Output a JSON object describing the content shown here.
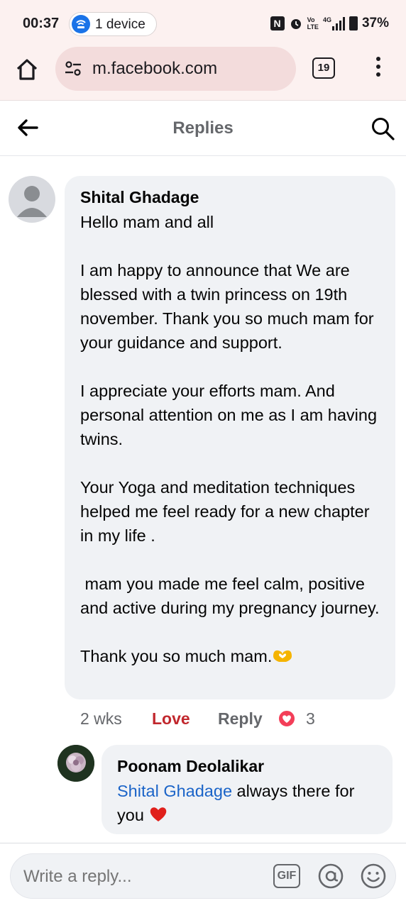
{
  "status_bar": {
    "time": "00:37",
    "device_chip": "1 device",
    "network_top": "Vo",
    "network_bottom": "LTE",
    "signal_label": "4G",
    "battery": "37%"
  },
  "browser": {
    "url": "m.facebook.com",
    "tab_count": "19"
  },
  "header": {
    "title": "Replies"
  },
  "comment": {
    "author": "Shital Ghadage",
    "text": "Hello mam and all\n\nI am happy to announce that We are blessed with a twin princess on 19th november. Thank you so much mam for your guidance and support.\n\nI appreciate your efforts mam. And personal attention on me as I am having twins.\n\nYour Yoga and meditation techniques helped me feel ready for a new chapter in my life .\n\n mam you made me feel calm, positive and active during my pregnancy journey.\n\nThank you so much mam.",
    "age": "2 wks",
    "reaction_label": "Love",
    "reply_label": "Reply",
    "reaction_count": "3"
  },
  "reply": {
    "author": "Poonam Deolalikar",
    "mention": "Shital Ghadage",
    "text": " always there for you"
  },
  "composer": {
    "placeholder": "Write a reply...",
    "gif_label": "GIF"
  },
  "icons": {
    "home": "home-icon",
    "site_settings": "tune-icon",
    "menu": "more-vert-icon",
    "back": "arrow-left-icon",
    "search": "search-icon",
    "reaction": "love-reaction-icon",
    "emoji": "heart-hands-emoji",
    "heart": "red-heart-emoji",
    "mention": "at-icon",
    "smiley": "smiley-icon"
  },
  "colors": {
    "love": "#c1272d",
    "mention": "#1b64c8",
    "bubble": "#f0f2f5",
    "browser_bg": "#fcf1f0"
  }
}
